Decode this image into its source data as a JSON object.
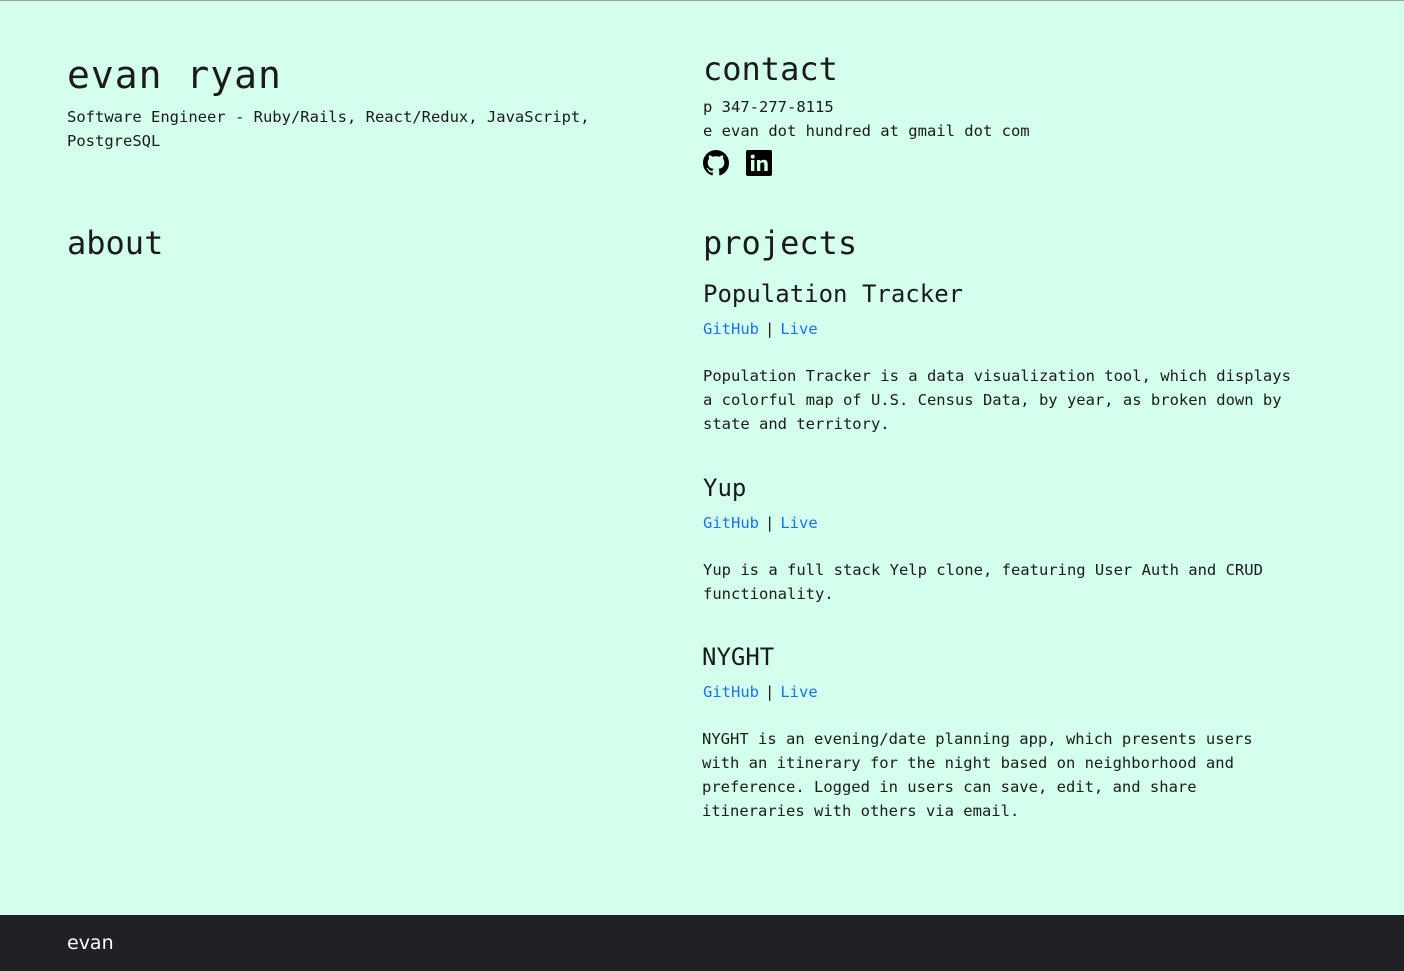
{
  "header": {
    "name": "evan ryan",
    "tagline": "Software Engineer - Ruby/Rails, React/Redux, JavaScript, PostgreSQL"
  },
  "about": {
    "heading": "about"
  },
  "contact": {
    "heading": "contact",
    "phone": "p 347-277-8115",
    "email": "e evan dot hundred at gmail dot com",
    "icons": [
      "github-icon",
      "linkedin-icon"
    ]
  },
  "projects": {
    "heading": "projects",
    "link_separator": "|",
    "items": [
      {
        "title": "Population Tracker",
        "github_label": "GitHub",
        "live_label": "Live",
        "description": "Population Tracker is a data visualization tool, which displays a colorful map of U.S. Census Data, by year, as broken down by state and territory."
      },
      {
        "title": "Yup",
        "github_label": "GitHub",
        "live_label": "Live",
        "description": "Yup is a full stack Yelp clone, featuring User Auth and CRUD functionality."
      },
      {
        "title": "NYGHT",
        "github_label": "GitHub",
        "live_label": "Live",
        "description": "NYGHT is an evening/date planning app, which presents users with an itinerary for the night based on neighborhood and preference. Logged in users can save, edit, and share itineraries with others via email."
      }
    ]
  },
  "colors": {
    "background": "#d3ffec",
    "text": "#1b1b1b",
    "link": "#1a73e8",
    "footer_bg": "#1f2124",
    "footer_text": "#ffffff"
  },
  "footer": {
    "text": "evan"
  }
}
